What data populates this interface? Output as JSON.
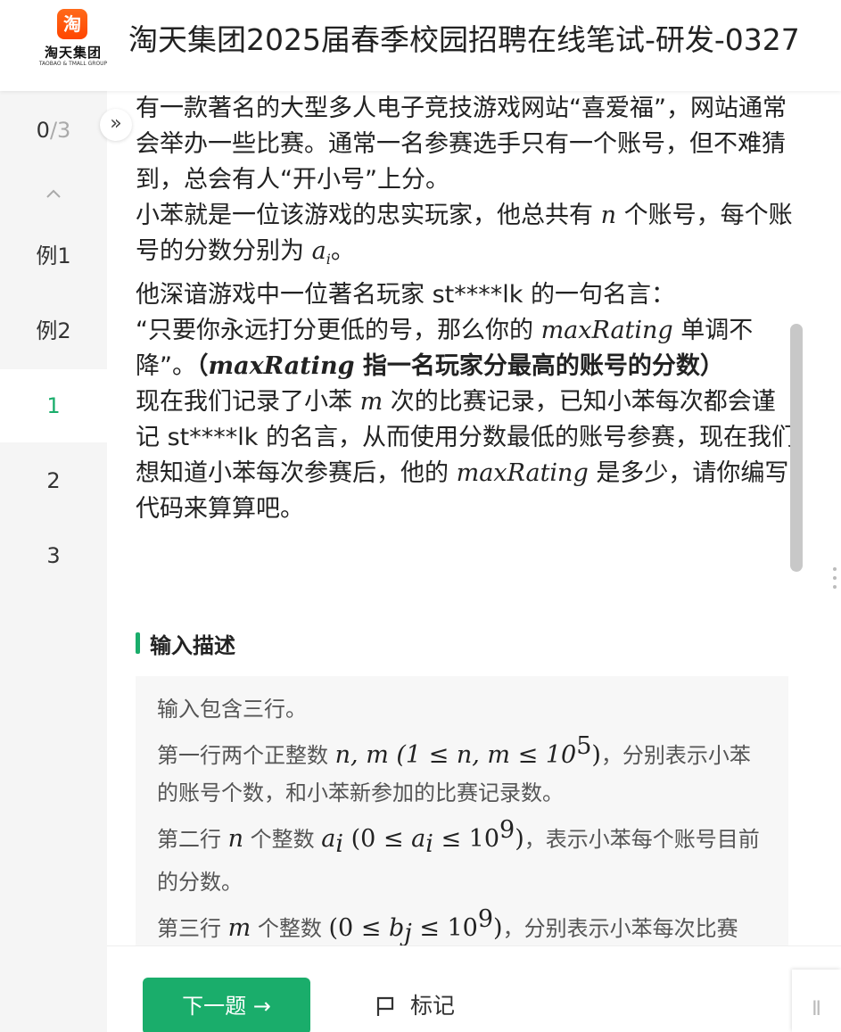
{
  "header": {
    "logo_glyph": "淘",
    "logo_name": "淘天集团",
    "logo_sub": "TAOBAO & TMALL GROUP",
    "title": "淘天集团2025届春季校园招聘在线笔试-研发-0327"
  },
  "nav": {
    "progress_done": "0",
    "progress_sep": "/",
    "progress_total": "3",
    "items": [
      {
        "label": "例1"
      },
      {
        "label": "例2"
      },
      {
        "label": "1",
        "active": true
      },
      {
        "label": "2"
      },
      {
        "label": "3"
      }
    ]
  },
  "expand_icon": "»",
  "problem": {
    "p1": "有一款著名的大型多人电子竞技游戏网站“喜爱福”，网站通常会举办一些比赛。通常一名参赛选手只有一个账号，但不难猜到，总会有人“开小号”上分。",
    "p2_a": "小苯就是一位该游戏的忠实玩家，他总共有 ",
    "p2_n": "n",
    "p2_b": " 个账号，每个账号的分数分别为 ",
    "p2_ai": "a",
    "p2_ai_sub": "i",
    "p2_c": "。",
    "p3": "他深谙游戏中一位著名玩家 st****lk 的一句名言：",
    "p4_a": "“只要你永远打分更低的号，那么你的 ",
    "p4_mr": "maxRating",
    "p4_b": " 单调不降”。",
    "p4_bold_a": "（",
    "p4_bold_mr": "maxRating",
    "p4_bold_b": " 指一名玩家分最高的账号的分数）",
    "p5_a": "现在我们记录了小苯 ",
    "p5_m": "m",
    "p5_b": " 次的比赛记录，已知小苯每次都会谨记 st****lk 的名言，从而使用分数最低的账号参赛，现在我们想知道小苯每次参赛后，他的 ",
    "p5_mr": "maxRating",
    "p5_c": " 是多少，请你编写代码来算算吧。"
  },
  "input_section": {
    "title": "输入描述",
    "l1": "输入包含三行。",
    "l2_a": "第一行两个正整数 ",
    "l2_math": "n, m (1 ≤ n, m ≤ 10",
    "l2_sup": "5",
    "l2_close": ")",
    "l2_b": "，分别表示小苯的账号个数，和小苯新参加的比赛记录数。",
    "l3_a": "第二行 ",
    "l3_n": "n",
    "l3_b": " 个整数 ",
    "l3_ai": "a",
    "l3_ai_sub": "i",
    "l3_math": " (0 ≤ ",
    "l3_ai2": "a",
    "l3_ai2_sub": "i",
    "l3_math2": " ≤ 10",
    "l3_sup": "9",
    "l3_close": ")",
    "l3_c": "，表示小苯每个账号目前的分数。",
    "l4_a": "第三行 ",
    "l4_m": "m",
    "l4_b": " 个整数 ",
    "l4_math": "(0 ≤ ",
    "l4_bj": "b",
    "l4_bj_sub": "j",
    "l4_math2": " ≤ 10",
    "l4_sup": "9",
    "l4_close": ")",
    "l4_c": "，分别表示小苯每次比赛后，分数的变化值。"
  },
  "bottom": {
    "next_label": "下一题 →",
    "mark_label": "标记",
    "corner_glyph": "Ⅱ"
  },
  "colors": {
    "accent": "#1aad6b",
    "brand": "#ff5a00"
  }
}
